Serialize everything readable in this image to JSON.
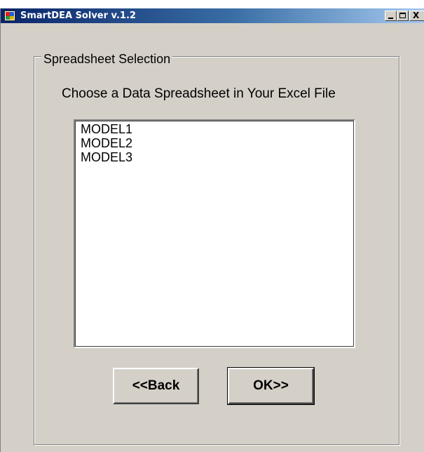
{
  "window": {
    "title": "SmartDEA Solver v.1.2",
    "controls": [
      "minimize-icon",
      "maximize-icon",
      "close-icon"
    ],
    "close_glyph": "X"
  },
  "group": {
    "legend": "Spreadsheet Selection",
    "prompt": "Choose a Data Spreadsheet in Your Excel File"
  },
  "sheets": {
    "items": [
      {
        "label": "MODEL1"
      },
      {
        "label": "MODEL2"
      },
      {
        "label": "MODEL3"
      }
    ]
  },
  "buttons": {
    "back_label": "<<Back",
    "ok_label": "OK>>"
  },
  "colors": {
    "face": "#d4d0c8",
    "titlebar_start": "#0a246a",
    "titlebar_end": "#a6caf0"
  }
}
